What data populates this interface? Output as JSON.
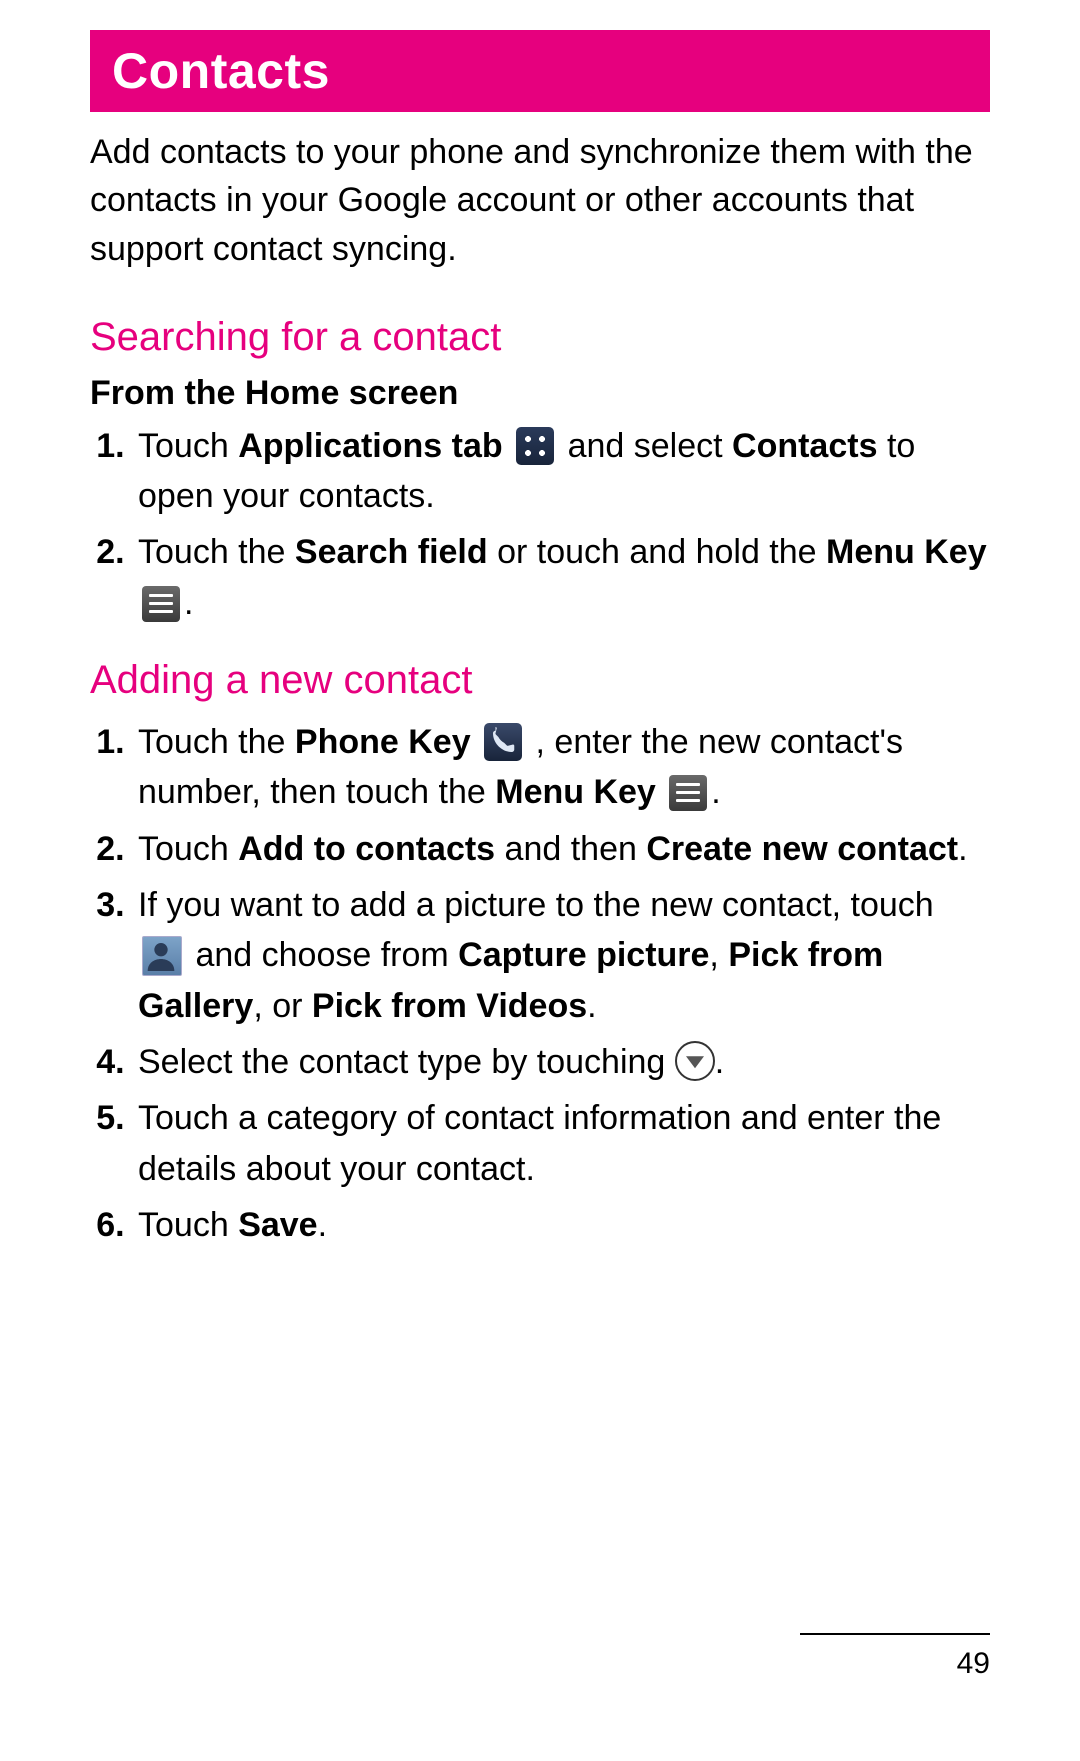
{
  "title": "Contacts",
  "intro": "Add contacts to your phone and synchronize them with the contacts in your Google account or other accounts that support contact syncing.",
  "section1": {
    "heading": "Searching for a contact",
    "subhead": "From the Home screen",
    "steps": {
      "s1": {
        "a": "Touch ",
        "b1": "Applications tab",
        "c": " and select ",
        "b2": "Contacts",
        "d": " to open your contacts."
      },
      "s2": {
        "a": "Touch the ",
        "b1": "Search field",
        "c": " or touch and hold the ",
        "b2": "Menu Key",
        "d": "",
        "tail": "."
      }
    }
  },
  "section2": {
    "heading": "Adding a new contact",
    "steps": {
      "s1": {
        "a": "Touch the ",
        "b1": "Phone Key",
        "c": " , enter the new contact's number, then touch the ",
        "b2": "Menu Key",
        "tail": "."
      },
      "s2": {
        "a": "Touch ",
        "b1": "Add to contacts",
        "c": " and then ",
        "b2": "Create new contact",
        "tail": "."
      },
      "s3": {
        "a": "If you want to add a picture to the new contact, touch ",
        "c": " and choose from ",
        "b1": "Capture picture",
        "comma1": ", ",
        "b2": "Pick from Gallery",
        "comma2": ", or ",
        "b3": "Pick from Videos",
        "tail": "."
      },
      "s4": {
        "a": "Select the contact type by touching ",
        "tail": "."
      },
      "s5": {
        "a": "Touch a category of contact information and enter the details about your contact."
      },
      "s6": {
        "a": "Touch ",
        "b1": "Save",
        "tail": "."
      }
    }
  },
  "page_number": "49"
}
